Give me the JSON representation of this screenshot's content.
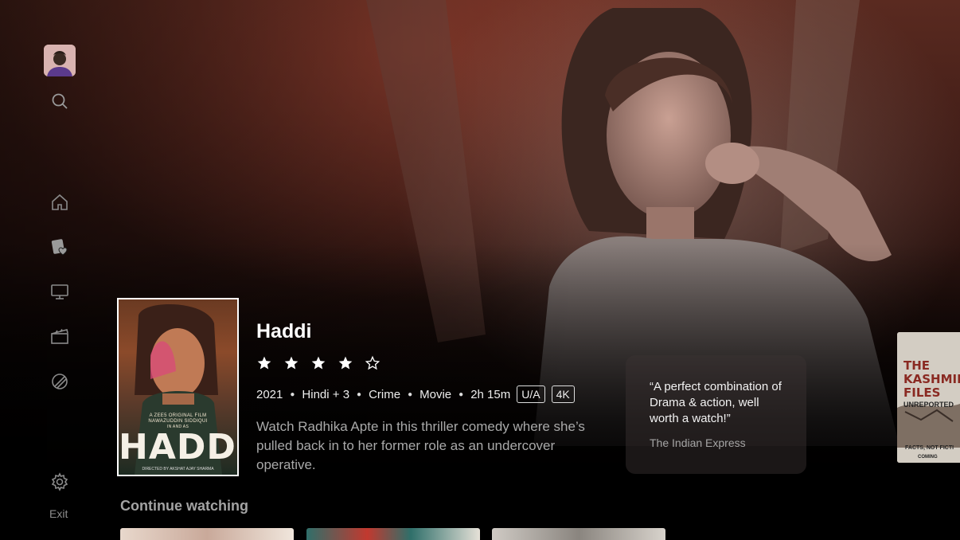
{
  "sidebar": {
    "items": [
      {
        "name": "search",
        "icon": "search-icon"
      },
      {
        "name": "home",
        "icon": "home-icon"
      },
      {
        "name": "favorites",
        "icon": "heart-card-icon"
      },
      {
        "name": "tv",
        "icon": "tv-icon"
      },
      {
        "name": "movies",
        "icon": "clapperboard-icon"
      },
      {
        "name": "sports",
        "icon": "ball-icon"
      },
      {
        "name": "settings",
        "icon": "gear-icon"
      }
    ],
    "exit_label": "Exit"
  },
  "featured": {
    "title": "Haddi",
    "rating_stars": 4,
    "rating_max": 5,
    "year": "2021",
    "language": "Hindi + 3",
    "genre": "Crime",
    "type": "Movie",
    "duration": "2h 15m",
    "badges": [
      "U/A",
      "4K"
    ],
    "description": "Watch Radhika Apte in this thriller comedy where she’s pulled back in to her former role as an undercover operative.",
    "poster": {
      "title": "HADDI",
      "credit_line1": "A ZEE5 ORIGINAL FILM",
      "credit_line2": "NAWAZUDDIN SIDDIQUI",
      "credit_line3": "IN AND AS",
      "director": "DIRECTED BY AKSHAT AJAY SHARMA"
    }
  },
  "review": {
    "quote": "“A perfect combination of Drama & action, well worth a watch!”",
    "source": "The Indian Express"
  },
  "next_poster": {
    "title_line1": "THE",
    "title_line2": "KASHMIR",
    "title_line3": "FILES",
    "subtitle": "UNREPORTED",
    "tagline": "FACTS, NOT FICTI",
    "coming": "COMING"
  },
  "continue_watching": {
    "heading": "Continue watching"
  },
  "colors": {
    "accent_text": "#ffffff",
    "muted_text": "#a9a9a9",
    "hero_tint": "#5a2a20"
  }
}
